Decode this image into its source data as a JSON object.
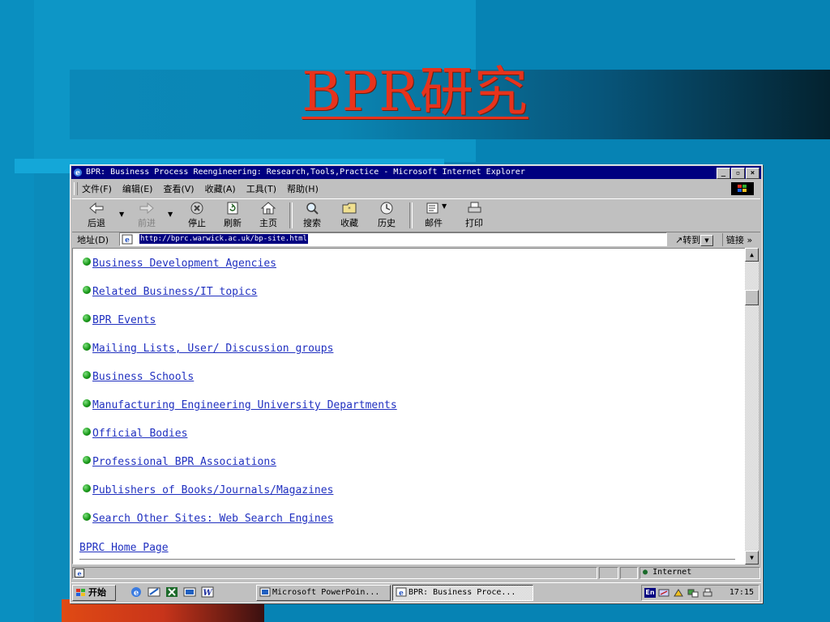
{
  "slide": {
    "title": "BPR研究"
  },
  "browser": {
    "window_title": "BPR: Business Process Reengineering: Research,Tools,Practice - Microsoft Internet Explorer",
    "window_buttons": [
      "_",
      "▫",
      "×"
    ],
    "menu": [
      "文件(F)",
      "编辑(E)",
      "查看(V)",
      "收藏(A)",
      "工具(T)",
      "帮助(H)"
    ],
    "toolbar": {
      "back": "后退",
      "forward": "前进",
      "stop": "停止",
      "refresh": "刷新",
      "home": "主页",
      "search": "搜索",
      "favorites": "收藏",
      "history": "历史",
      "mail": "邮件",
      "print": "打印"
    },
    "address": {
      "label": "地址(D)",
      "url": "http://bprc.warwick.ac.uk/bp-site.html",
      "go": "转到",
      "links": "链接 »"
    },
    "links": [
      "Business Development Agencies",
      "Related Business/IT topics",
      "BPR Events",
      "Mailing Lists, User/ Discussion groups",
      "Business Schools",
      "Manufacturing Engineering University Departments",
      "Official Bodies",
      "Professional BPR Associations",
      "Publishers of Books/Journals/Magazines",
      "Search Other Sites: Web Search Engines"
    ],
    "home_link": "BPRC Home Page",
    "status": {
      "zone": "Internet"
    }
  },
  "taskbar": {
    "start": "开始",
    "tasks": [
      "Microsoft PowerPoin...",
      "BPR: Business Proce..."
    ],
    "tray_lang": "En",
    "clock": "17:15"
  },
  "colors": {
    "slide_bg": "#0683b4",
    "title": "#e8331c",
    "link": "#2030c0",
    "titlebar": "#000080"
  }
}
